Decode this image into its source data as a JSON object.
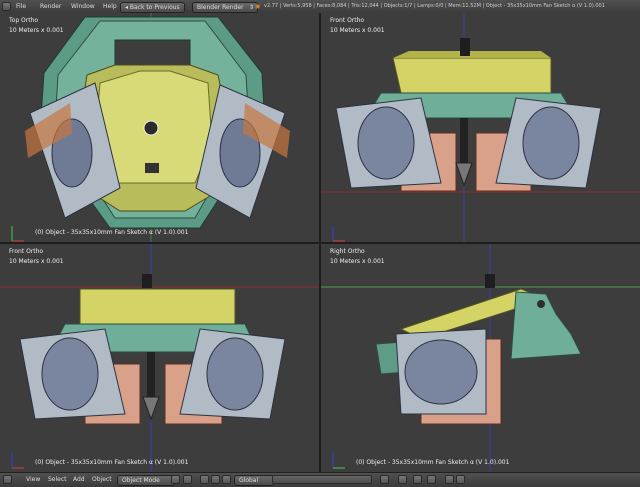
{
  "menubar": {
    "menus": [
      "File",
      "Render",
      "Window",
      "Help"
    ],
    "back_label": "Back to Previous",
    "engine": "Blender Render",
    "stats": "v2.77 | Verts:5,958 | Faces:8,084 | Tris:12,044 | Objects:1/7 | Lamps:0/0 | Mem:11.52M | Object - 35x35x10mm Fan Sketch α (V 1.0).001"
  },
  "viewports": [
    {
      "title": "Top Ortho",
      "scale": "10 Meters x 0.001",
      "object": "(0) Object - 35x35x10mm Fan Sketch α (V 1.0).001"
    },
    {
      "title": "Front Ortho",
      "scale": "10 Meters x 0.001",
      "object": "(0) Object - 35x35x10mm Fan Sketch α (V 1.0).001"
    },
    {
      "title": "Front Ortho",
      "scale": "10 Meters x 0.001",
      "object": "(0) Object - 35x35x10mm Fan Sketch α (V 1.0).001"
    },
    {
      "title": "Right Ortho",
      "scale": "10 Meters x 0.001",
      "object": "(0) Object - 35x35x10mm Fan Sketch α (V 1.0).001"
    }
  ],
  "footer": {
    "view": "View",
    "select": "Select",
    "add": "Add",
    "object": "Object",
    "mode": "Object Mode",
    "orientation": "Global"
  }
}
